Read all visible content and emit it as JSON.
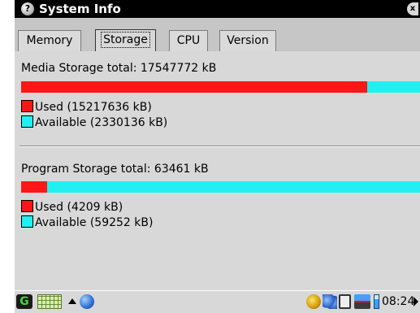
{
  "window": {
    "title": "System Info",
    "title_icon": "?",
    "close_icon": "x"
  },
  "tabs": [
    {
      "label": "Memory",
      "active": false
    },
    {
      "label": "Storage",
      "active": true
    },
    {
      "label": "CPU",
      "active": false
    },
    {
      "label": "Version",
      "active": false
    }
  ],
  "colors": {
    "used": "#ff1616",
    "available": "#22f0f0"
  },
  "media": {
    "title": "Media Storage total: 17547772 kB",
    "used_label": "Used (15217636 kB)",
    "available_label": "Available (2330136 kB)",
    "used_fraction": 0.867
  },
  "program": {
    "title": "Program Storage total: 63461 kB",
    "used_label": "Used (4209 kB)",
    "available_label": "Available (59252 kB)",
    "used_fraction": 0.066
  },
  "taskbar": {
    "start_glyph": "G",
    "clock": "08:24"
  }
}
